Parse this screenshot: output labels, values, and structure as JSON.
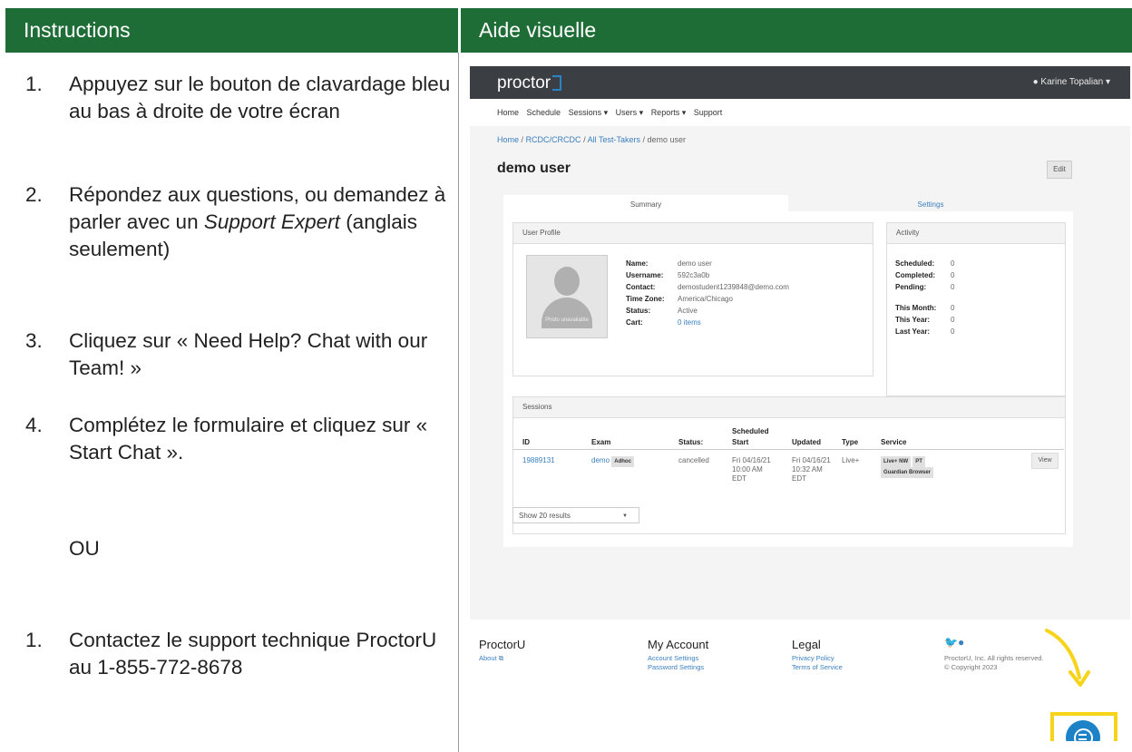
{
  "headers": {
    "left": "Instructions",
    "right": "Aide visuelle"
  },
  "steps": [
    {
      "num": "1.",
      "text": "Appuyez sur le bouton de clavardage bleu au bas à droite de votre écran"
    },
    {
      "num": "2.",
      "text_a": "Répondez aux questions, ou demandez à parler avec un ",
      "text_em": "Support Expert",
      "text_b": " (anglais seulement)"
    },
    {
      "num": "3.",
      "text": "Cliquez sur « Need Help? Chat with our Team! »"
    },
    {
      "num": "4.",
      "text": "Complétez le formulaire et cliquez sur « Start Chat »."
    }
  ],
  "or_label": "OU",
  "alt_step": {
    "num": "1.",
    "text": "Contactez le support technique ProctorU au 1-855-772-8678"
  },
  "screenshot": {
    "logo": "proctor",
    "user_menu": "Karine Topalian",
    "nav": [
      "Home",
      "Schedule",
      "Sessions ▾",
      "Users ▾",
      "Reports ▾",
      "Support"
    ],
    "breadcrumb": [
      "Home",
      "RCDC/CRCDC",
      "All Test-Takers",
      "demo user"
    ],
    "page_title": "demo user",
    "edit_label": "Edit",
    "tabs": [
      "Summary",
      "Settings"
    ],
    "profile": {
      "header": "User Profile",
      "photo_caption": "Photo unavailable",
      "fields": [
        {
          "k": "Name:",
          "v": "demo user"
        },
        {
          "k": "Username:",
          "v": "592c3a0b"
        },
        {
          "k": "Contact:",
          "v": "demostudent1239848@demo.com"
        },
        {
          "k": "Time Zone:",
          "v": "America/Chicago"
        },
        {
          "k": "Status:",
          "v": "Active"
        },
        {
          "k": "Cart:",
          "v": "0 items"
        }
      ]
    },
    "activity": {
      "header": "Activity",
      "rows": [
        {
          "k": "Scheduled:",
          "v": "0"
        },
        {
          "k": "Completed:",
          "v": "0"
        },
        {
          "k": "Pending:",
          "v": "0"
        },
        {
          "k": "This Month:",
          "v": "0"
        },
        {
          "k": "This Year:",
          "v": "0"
        },
        {
          "k": "Last Year:",
          "v": "0"
        }
      ]
    },
    "sessions": {
      "header": "Sessions",
      "columns": [
        "ID",
        "Exam",
        "Status:",
        "Scheduled",
        "Start",
        "Updated",
        "Type",
        "Service"
      ],
      "row": {
        "id": "19889131",
        "exam": "demo",
        "exam_badge": "Adhoc",
        "status": "cancelled",
        "start": [
          "Fri 04/16/21",
          "10:00 AM",
          "EDT"
        ],
        "updated": [
          "Fri 04/16/21",
          "10:32 AM",
          "EDT"
        ],
        "type": "Live+",
        "service_badges": [
          "Live+ NW",
          "PT"
        ],
        "service_badge2": "Guardian Browser",
        "view": "View"
      },
      "show_results": "Show 20 results"
    },
    "footer": {
      "col1_title": "ProctorU",
      "col1_link": "About",
      "col2_title": "My Account",
      "col2_links": [
        "Account Settings",
        "Password Settings"
      ],
      "col3_title": "Legal",
      "col3_links": [
        "Privacy Policy",
        "Terms of Service"
      ],
      "social": "twitter-github",
      "rights": "ProctorU, Inc. All rights reserved.",
      "copyright": "© Copyright 2023"
    },
    "accent_color": "#1d83c6",
    "highlight_color": "#f7d319",
    "header_color": "#1f6d36"
  }
}
